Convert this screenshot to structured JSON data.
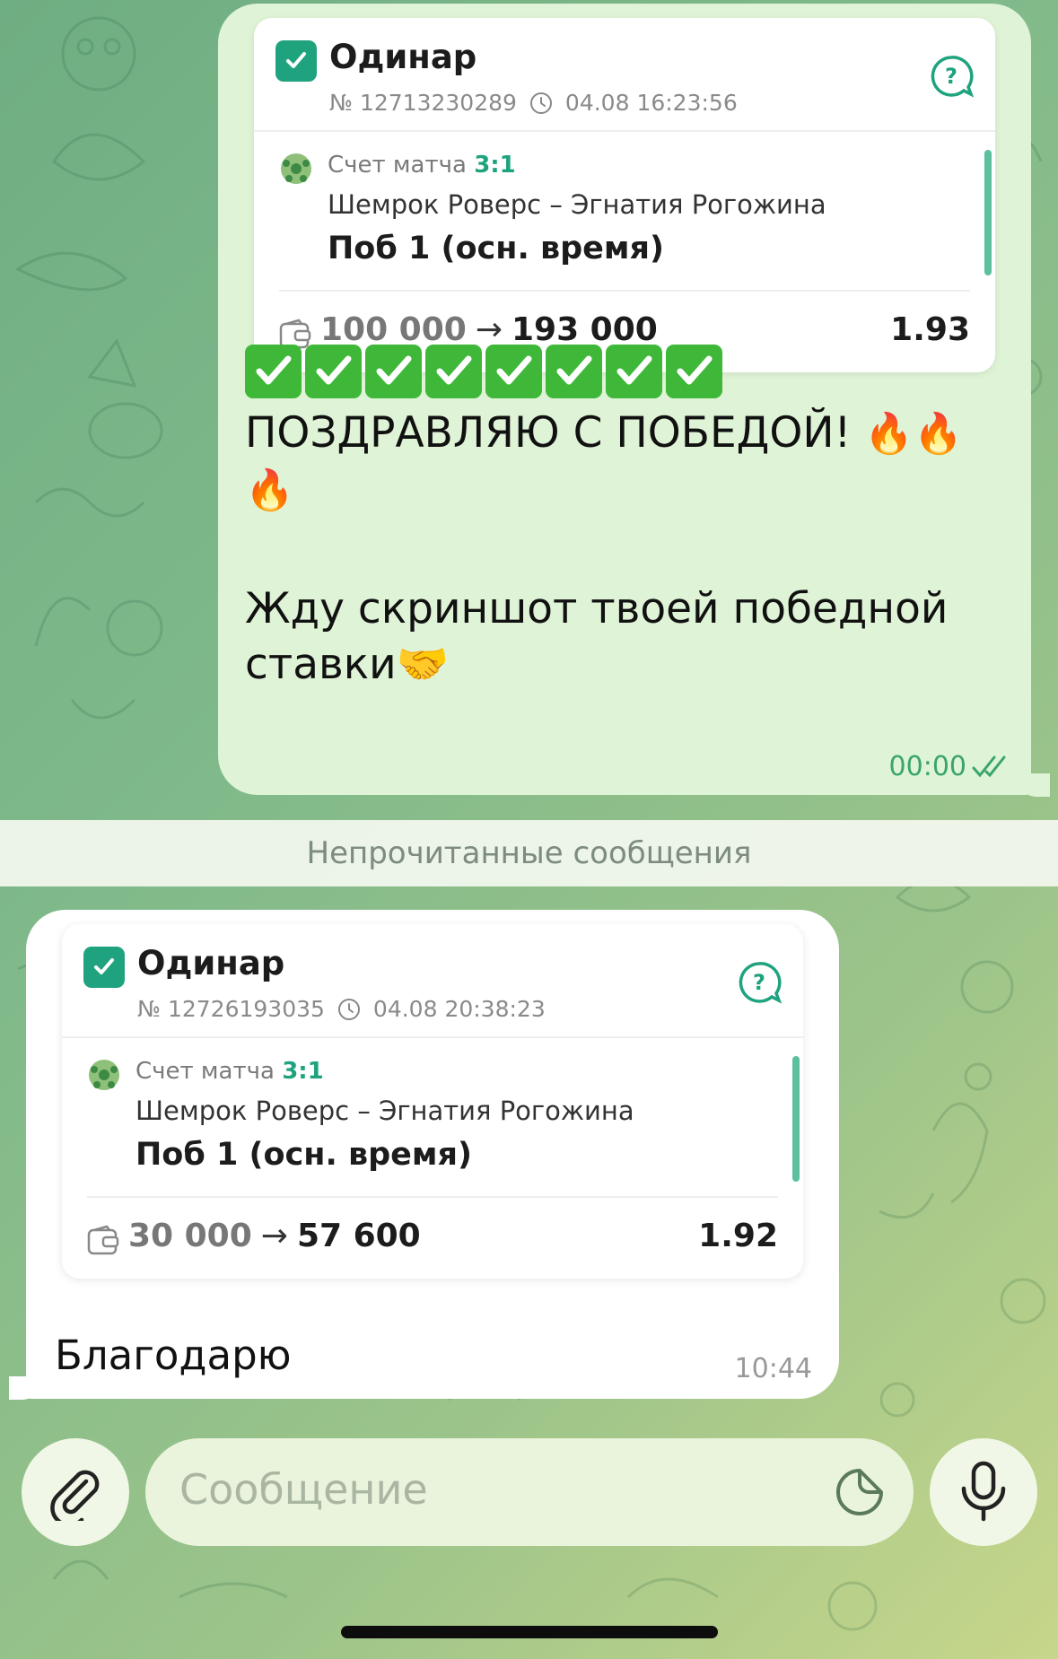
{
  "colors": {
    "accent": "#1fa37f",
    "outgoing_bubble": "#dff3d6",
    "incoming_bubble": "#ffffff",
    "time_out": "#3aa56b"
  },
  "outgoing": {
    "bet": {
      "title": "Одинар",
      "number": "№ 12713230289",
      "datetime": "04.08 16:23:56",
      "score_label": "Счет матча",
      "score": "3:1",
      "teams": "Шемрок Роверс – Эгнатия Рогожина",
      "market": "Поб 1 (осн. время)",
      "stake": "100 000",
      "payout": "193 000",
      "odds": "1.93"
    },
    "congrats": "ПОЗДРАВЛЯЮ С ПОБЕДОЙ!",
    "message": "Жду скриншот твоей победной ставки",
    "handshake": "🤝",
    "fire": "🔥",
    "time": "00:00"
  },
  "unread_divider": "Непрочитанные сообщения",
  "incoming": {
    "bet": {
      "title": "Одинар",
      "number": "№ 12726193035",
      "datetime": "04.08 20:38:23",
      "score_label": "Счет матча",
      "score": "3:1",
      "teams": "Шемрок Роверс – Эгнатия Рогожина",
      "market": "Поб 1 (осн. время)",
      "stake": "30 000",
      "payout": "57 600",
      "odds": "1.92"
    },
    "message": "Благодарю",
    "time": "10:44"
  },
  "composer": {
    "placeholder": "Сообщение",
    "icons": [
      "paperclip-icon",
      "sticker-icon",
      "microphone-icon"
    ]
  }
}
